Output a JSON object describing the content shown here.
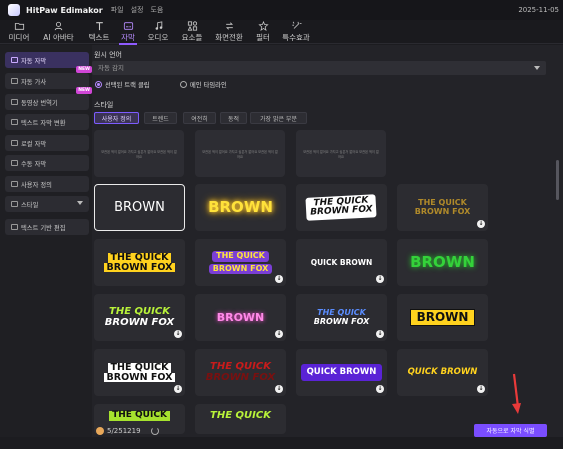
{
  "app": {
    "title": "HitPaw Edimakor",
    "menu": [
      "파일",
      "설정",
      "도움"
    ],
    "date": "2025-11-05"
  },
  "toolbar": [
    {
      "label": "미디어",
      "icon": "folder-icon"
    },
    {
      "label": "AI 아바타",
      "icon": "ai-avatar-icon"
    },
    {
      "label": "텍스트",
      "icon": "text-icon"
    },
    {
      "label": "자막",
      "icon": "subtitle-icon",
      "active": true
    },
    {
      "label": "오디오",
      "icon": "music-note-icon"
    },
    {
      "label": "요소들",
      "icon": "shapes-icon"
    },
    {
      "label": "화면전환",
      "icon": "transition-icon"
    },
    {
      "label": "필터",
      "icon": "filter-icon"
    },
    {
      "label": "특수효과",
      "icon": "effects-icon"
    }
  ],
  "sidebar": [
    {
      "label": "자동 자막",
      "active": true,
      "badge": ""
    },
    {
      "label": "자동 가사",
      "badge": "NEW"
    },
    {
      "label": "동영상 번역기",
      "badge": "NEW"
    },
    {
      "label": "텍스트 자막 변환",
      "badge": ""
    },
    {
      "label": "로컬 자막",
      "badge": ""
    },
    {
      "label": "수동 자막",
      "badge": ""
    },
    {
      "label": "사용자 정의",
      "badge": ""
    },
    {
      "label": "스타일",
      "badge": "",
      "dropdown": true
    },
    {
      "label": "텍스트 기반 편집",
      "badge": ""
    }
  ],
  "main": {
    "source_language_label": "원시 언어",
    "language_value": "자동 감지",
    "radio_selected_clips": "선택된 트랙 클립",
    "radio_main_timeline": "메인 타임라인",
    "style_label": "스타일",
    "style_tabs": [
      "사용자 정의",
      "트렌드",
      "여전히",
      "동적",
      "가장 밝은 부분"
    ],
    "placeholder_text": "보관된 적이 없어요 가지고 싶은거 없어요 보관된 적이 없어요"
  },
  "styles": [
    {
      "lines": [
        "BROWN"
      ]
    },
    {
      "lines": [
        "BROWN"
      ]
    },
    {
      "lines": [
        "THE QUICK",
        "BROWN FOX"
      ]
    },
    {
      "lines": [
        "THE QUICK",
        "BROWN FOX"
      ]
    },
    {
      "lines": [
        "THE QUICK",
        "BROWN FOX"
      ]
    },
    {
      "lines": [
        "THE QUICK",
        "BROWN FOX"
      ]
    },
    {
      "lines": [
        "QUICK BROWN"
      ]
    },
    {
      "lines": [
        "BROWN"
      ]
    },
    {
      "lines": [
        "THE QUICK",
        "BROWN FOX"
      ]
    },
    {
      "lines": [
        "BROWN"
      ]
    },
    {
      "lines": [
        "THE QUICK",
        "BROWN FOX"
      ]
    },
    {
      "lines": [
        "BROWN"
      ]
    },
    {
      "lines": [
        "THE QUICK",
        "BROWN FOX"
      ]
    },
    {
      "lines": [
        "THE QUICK",
        "BROWN FOX"
      ]
    },
    {
      "lines": [
        "QUICK BROWN"
      ]
    },
    {
      "lines": [
        "QUICK BROWN"
      ]
    },
    {
      "lines": [
        "THE QUICK"
      ]
    },
    {
      "lines": [
        "THE QUICK"
      ]
    }
  ],
  "footer": {
    "credits": "5/251219",
    "generate_button": "자동으로 자막 식별"
  },
  "colors": {
    "accent": "#7a4dff",
    "selected_tab": "#b88cff"
  }
}
